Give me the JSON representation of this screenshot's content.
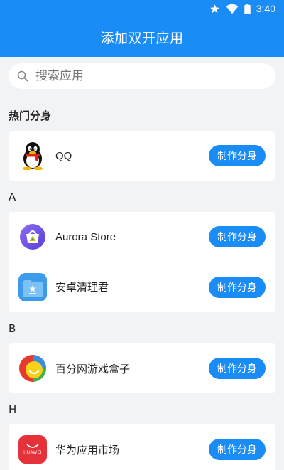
{
  "status_bar": {
    "time": "3:40",
    "icons": [
      "star-icon",
      "wifi-icon",
      "battery-icon"
    ]
  },
  "header": {
    "title": "添加双开应用",
    "background": "#1a8cf5"
  },
  "search": {
    "placeholder": "搜索应用",
    "value": ""
  },
  "sections": [
    {
      "title": "热门分身",
      "apps": [
        {
          "name": "QQ",
          "icon": "qq-penguin-icon",
          "button_label": "制作分身"
        }
      ]
    },
    {
      "title": "A",
      "apps": [
        {
          "name": "Aurora Store",
          "icon": "aurora-store-icon",
          "button_label": "制作分身"
        },
        {
          "name": "安卓清理君",
          "icon": "cleaner-icon",
          "button_label": "制作分身"
        }
      ]
    },
    {
      "title": "B",
      "apps": [
        {
          "name": "百分网游戏盒子",
          "icon": "game-box-icon",
          "button_label": "制作分身"
        }
      ]
    },
    {
      "title": "H",
      "apps": [
        {
          "name": "华为应用市场",
          "icon": "huawei-appgallery-icon",
          "button_label": "制作分身",
          "icon_text": "HUAWEI"
        }
      ]
    }
  ],
  "colors": {
    "accent": "#1a8cf5",
    "background": "#f2f3f5"
  }
}
